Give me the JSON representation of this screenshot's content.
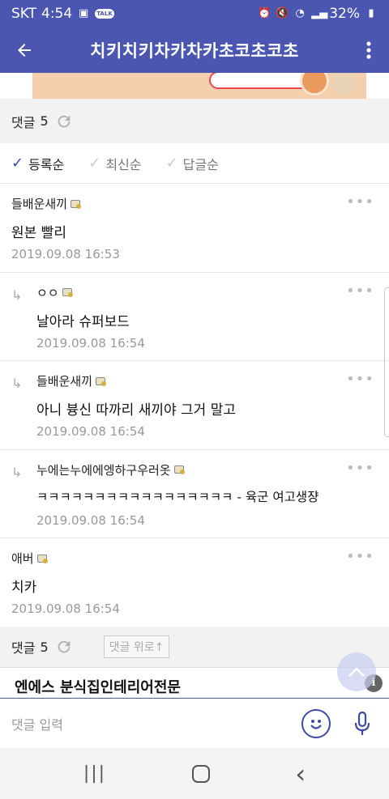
{
  "status_bar": {
    "carrier": "SKT",
    "time": "4:54",
    "battery": "32%"
  },
  "app_bar": {
    "title": "치키치키차카차카초코초코초"
  },
  "comment_header": {
    "label": "댓글",
    "count": "5"
  },
  "sort_options": [
    {
      "label": "등록순",
      "active": true
    },
    {
      "label": "최신순",
      "active": false
    },
    {
      "label": "답글순",
      "active": false
    }
  ],
  "comments": [
    {
      "author": "들배운새끼",
      "body": "원본 빨리",
      "date": "2019.09.08 16:53",
      "reply": false
    },
    {
      "author": "ㅇㅇ",
      "body": "날아라 슈퍼보드",
      "date": "2019.09.08 16:54",
      "reply": true
    },
    {
      "author": "들배운새끼",
      "body": "아니 븅신 따까리 새끼야 그거 말고",
      "date": "2019.09.08 16:54",
      "reply": true
    },
    {
      "author": "누에는누에에엥하구우러옷",
      "body": "ㅋㅋㅋㅋㅋㅋㅋㅋㅋㅋㅋㅋㅋㅋㅋㅋㅋ - 육군 여고생쟝",
      "date": "2019.09.08 16:54",
      "reply": true
    },
    {
      "author": "애버",
      "body": "치카",
      "date": "2019.09.08 16:54",
      "reply": false
    }
  ],
  "footer": {
    "label": "댓글",
    "count": "5",
    "up_button": "댓글 위로↑"
  },
  "ad": {
    "text": "엔에스 분식집인테리어전문"
  },
  "input": {
    "placeholder": "댓글 입력"
  },
  "colors": {
    "brand": "#4a56b0",
    "accent": "#3f4aa6"
  }
}
